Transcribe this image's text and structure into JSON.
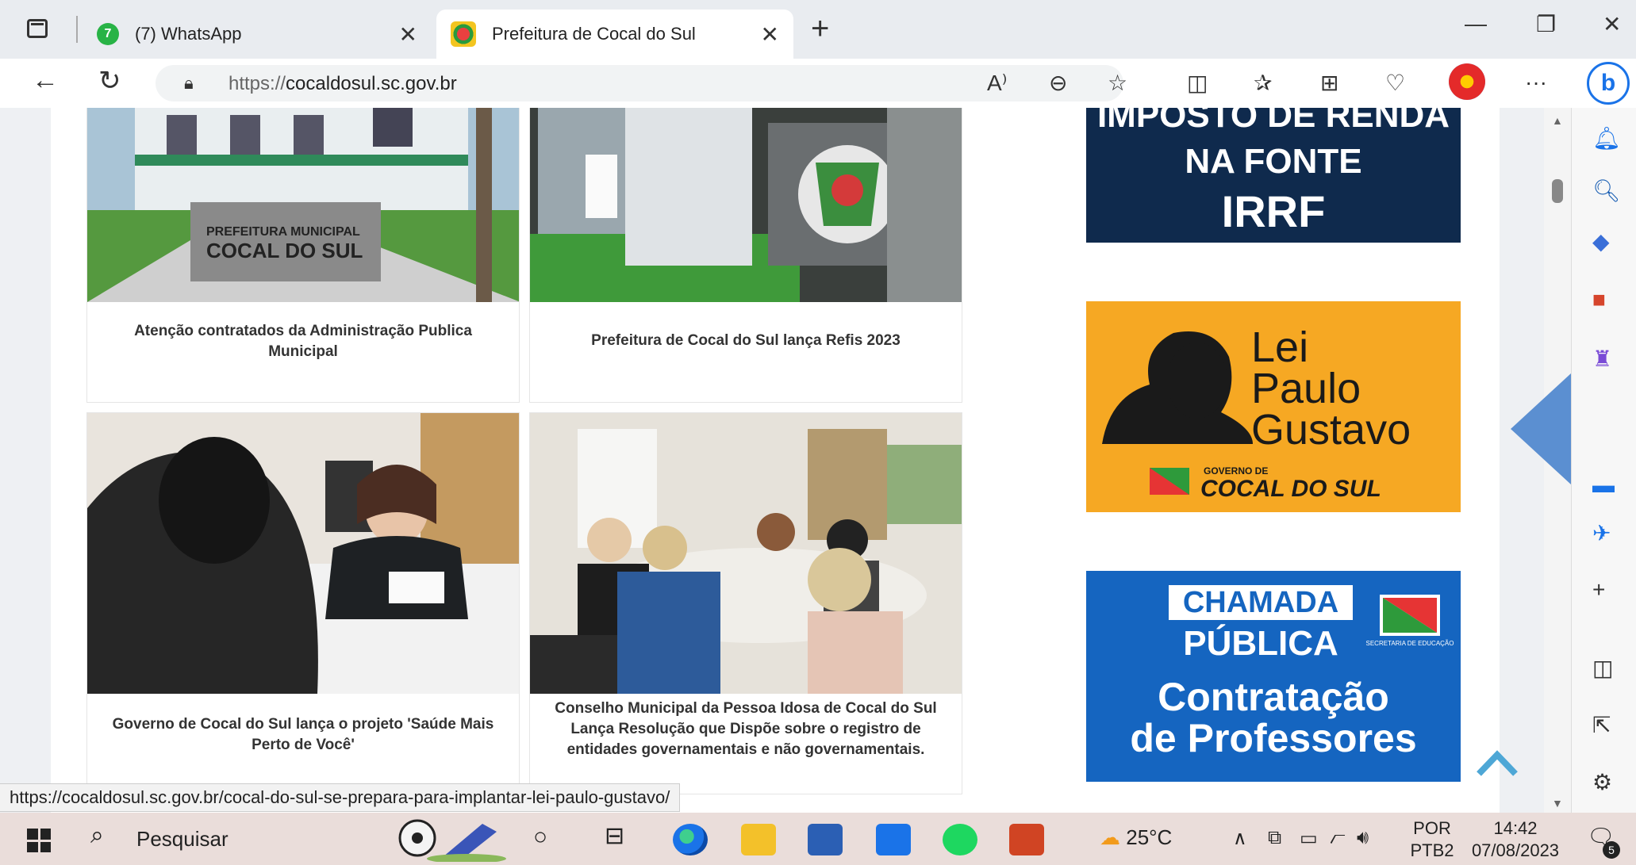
{
  "tabs": [
    {
      "title": "(7) WhatsApp",
      "badge": "7"
    },
    {
      "title": "Prefeitura de Cocal do Sul"
    }
  ],
  "address": {
    "protocol": "https://",
    "host": "cocaldosul.sc.gov.br"
  },
  "news": [
    {
      "title": "Atenção contratados da Administração Publica Municipal",
      "sign_line1": "PREFEITURA MUNICIPAL",
      "sign_line2": "COCAL DO SUL"
    },
    {
      "title": "Prefeitura de Cocal do Sul lança Refis 2023"
    },
    {
      "title": "Governo de Cocal do Sul lança o projeto 'Saúde Mais Perto de Você'"
    },
    {
      "title": "Conselho Municipal da Pessoa Idosa de Cocal do Sul Lança Resolução que Dispõe sobre o registro de entidades governamentais e não governamentais."
    }
  ],
  "banners": {
    "irrf": {
      "line1": "IMPOSTO DE RENDA",
      "line2": "NA FONTE",
      "line3": "IRRF",
      "bg": "#0f2a4d"
    },
    "lpg": {
      "line1": "Lei",
      "line2": "Paulo",
      "line3": "Gustavo",
      "gov_label": "GOVERNO DE",
      "gov_name": "COCAL DO SUL",
      "bg": "#f6a823"
    },
    "chamada": {
      "line1": "CHAMADA",
      "line2": "PÚBLICA",
      "line3": "Contratação",
      "line4": "de Professores",
      "secretaria": "SECRETARIA DE EDUCAÇÃO",
      "bg": "#1565c0"
    }
  },
  "status_url": "https://cocaldosul.sc.gov.br/cocal-do-sul-se-prepara-para-implantar-lei-paulo-gustavo/",
  "taskbar": {
    "search_label": "Pesquisar",
    "weather": "25°C",
    "lang_top": "POR",
    "lang_bottom": "PTB2",
    "time": "14:42",
    "date": "07/08/2023",
    "notifications": "5"
  }
}
